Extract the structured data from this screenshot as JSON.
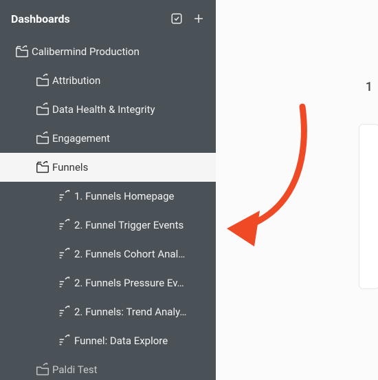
{
  "header": {
    "title": "Dashboards"
  },
  "tree": {
    "root": {
      "label": "Calibermind Production"
    },
    "folders": [
      {
        "label": "Attribution"
      },
      {
        "label": "Data Health & Integrity"
      },
      {
        "label": "Engagement"
      },
      {
        "label": "Funnels"
      }
    ],
    "funnels_children": [
      {
        "label": "1. Funnels Homepage"
      },
      {
        "label": "2. Funnel Trigger Events"
      },
      {
        "label": "2. Funnels Cohort Anal…"
      },
      {
        "label": "2. Funnels Pressure Ev…"
      },
      {
        "label": "2. Funnels: Trend Analy…"
      },
      {
        "label": "Funnel: Data Explore"
      }
    ],
    "tail_folder": {
      "label": "Paldi Test"
    }
  },
  "main_hint_number": "1",
  "arrow_color": "#ef4a26"
}
